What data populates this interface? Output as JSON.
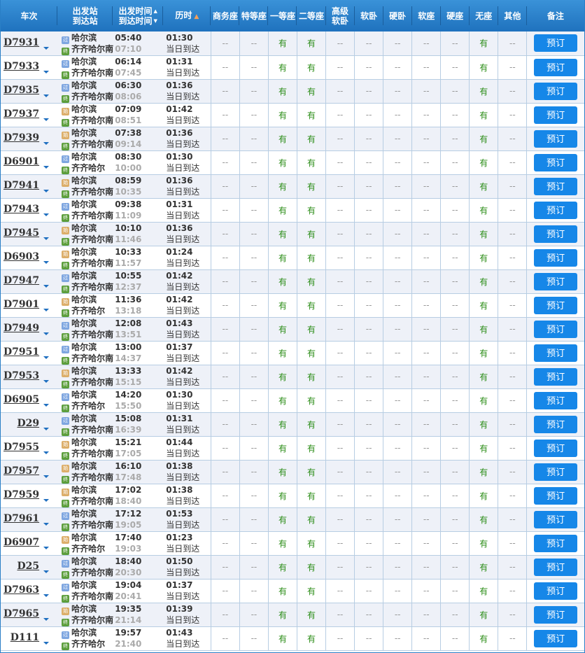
{
  "header": {
    "train": "车次",
    "stations_top": "出发站",
    "stations_bottom": "到达站",
    "times_top": "出发时间",
    "times_bottom": "到达时间",
    "duration": "历时",
    "seat_columns": [
      "商务座",
      "特等座",
      "一等座",
      "二等座",
      "高级软卧",
      "软卧",
      "硬卧",
      "软座",
      "硬座",
      "无座",
      "其他"
    ],
    "seat_col_gaoji_top": "高级",
    "seat_col_gaoji_bottom": "软卧",
    "remark": "备注"
  },
  "icons": {
    "guo": {
      "name": "pass-through-station-icon",
      "glyph": "过",
      "color": "#7ea6e0"
    },
    "shi": {
      "name": "origin-station-icon",
      "glyph": "始",
      "color": "#dcae6a"
    },
    "zhong": {
      "name": "terminal-station-icon",
      "glyph": "终",
      "color": "#5c9e3c"
    }
  },
  "labels": {
    "same_day_arrival": "当日到达",
    "book": "预订",
    "available": "有",
    "none": "--"
  },
  "colors": {
    "header_bg": "#2a7fc6",
    "available_text": "#2a8c16",
    "book_button": "#1687e8"
  },
  "rows": [
    {
      "train": "D7931",
      "dep_type": "guo",
      "from": "哈尔滨",
      "to": "齐齐哈尔南",
      "dep": "05:40",
      "arr": "07:10",
      "duration": "01:30"
    },
    {
      "train": "D7933",
      "dep_type": "guo",
      "from": "哈尔滨",
      "to": "齐齐哈尔南",
      "dep": "06:14",
      "arr": "07:45",
      "duration": "01:31"
    },
    {
      "train": "D7935",
      "dep_type": "guo",
      "from": "哈尔滨",
      "to": "齐齐哈尔南",
      "dep": "06:30",
      "arr": "08:06",
      "duration": "01:36"
    },
    {
      "train": "D7937",
      "dep_type": "shi",
      "from": "哈尔滨",
      "to": "齐齐哈尔南",
      "dep": "07:09",
      "arr": "08:51",
      "duration": "01:42"
    },
    {
      "train": "D7939",
      "dep_type": "shi",
      "from": "哈尔滨",
      "to": "齐齐哈尔南",
      "dep": "07:38",
      "arr": "09:14",
      "duration": "01:36"
    },
    {
      "train": "D6901",
      "dep_type": "guo",
      "from": "哈尔滨",
      "to": "齐齐哈尔",
      "dep": "08:30",
      "arr": "10:00",
      "duration": "01:30"
    },
    {
      "train": "D7941",
      "dep_type": "shi",
      "from": "哈尔滨",
      "to": "齐齐哈尔南",
      "dep": "08:59",
      "arr": "10:35",
      "duration": "01:36"
    },
    {
      "train": "D7943",
      "dep_type": "guo",
      "from": "哈尔滨",
      "to": "齐齐哈尔南",
      "dep": "09:38",
      "arr": "11:09",
      "duration": "01:31"
    },
    {
      "train": "D7945",
      "dep_type": "shi",
      "from": "哈尔滨",
      "to": "齐齐哈尔南",
      "dep": "10:10",
      "arr": "11:46",
      "duration": "01:36"
    },
    {
      "train": "D6903",
      "dep_type": "shi",
      "from": "哈尔滨",
      "to": "齐齐哈尔南",
      "dep": "10:33",
      "arr": "11:57",
      "duration": "01:24"
    },
    {
      "train": "D7947",
      "dep_type": "guo",
      "from": "哈尔滨",
      "to": "齐齐哈尔南",
      "dep": "10:55",
      "arr": "12:37",
      "duration": "01:42"
    },
    {
      "train": "D7901",
      "dep_type": "shi",
      "from": "哈尔滨",
      "to": "齐齐哈尔",
      "dep": "11:36",
      "arr": "13:18",
      "duration": "01:42"
    },
    {
      "train": "D7949",
      "dep_type": "guo",
      "from": "哈尔滨",
      "to": "齐齐哈尔南",
      "dep": "12:08",
      "arr": "13:51",
      "duration": "01:43"
    },
    {
      "train": "D7951",
      "dep_type": "guo",
      "from": "哈尔滨",
      "to": "齐齐哈尔南",
      "dep": "13:00",
      "arr": "14:37",
      "duration": "01:37"
    },
    {
      "train": "D7953",
      "dep_type": "shi",
      "from": "哈尔滨",
      "to": "齐齐哈尔南",
      "dep": "13:33",
      "arr": "15:15",
      "duration": "01:42"
    },
    {
      "train": "D6905",
      "dep_type": "guo",
      "from": "哈尔滨",
      "to": "齐齐哈尔",
      "dep": "14:20",
      "arr": "15:50",
      "duration": "01:30"
    },
    {
      "train": "D29",
      "dep_type": "guo",
      "from": "哈尔滨",
      "to": "齐齐哈尔南",
      "dep": "15:08",
      "arr": "16:39",
      "duration": "01:31"
    },
    {
      "train": "D7955",
      "dep_type": "shi",
      "from": "哈尔滨",
      "to": "齐齐哈尔南",
      "dep": "15:21",
      "arr": "17:05",
      "duration": "01:44"
    },
    {
      "train": "D7957",
      "dep_type": "shi",
      "from": "哈尔滨",
      "to": "齐齐哈尔南",
      "dep": "16:10",
      "arr": "17:48",
      "duration": "01:38"
    },
    {
      "train": "D7959",
      "dep_type": "shi",
      "from": "哈尔滨",
      "to": "齐齐哈尔南",
      "dep": "17:02",
      "arr": "18:40",
      "duration": "01:38"
    },
    {
      "train": "D7961",
      "dep_type": "guo",
      "from": "哈尔滨",
      "to": "齐齐哈尔南",
      "dep": "17:12",
      "arr": "19:05",
      "duration": "01:53"
    },
    {
      "train": "D6907",
      "dep_type": "shi",
      "from": "哈尔滨",
      "to": "齐齐哈尔",
      "dep": "17:40",
      "arr": "19:03",
      "duration": "01:23"
    },
    {
      "train": "D25",
      "dep_type": "guo",
      "from": "哈尔滨",
      "to": "齐齐哈尔南",
      "dep": "18:40",
      "arr": "20:30",
      "duration": "01:50"
    },
    {
      "train": "D7963",
      "dep_type": "guo",
      "from": "哈尔滨",
      "to": "齐齐哈尔南",
      "dep": "19:04",
      "arr": "20:41",
      "duration": "01:37"
    },
    {
      "train": "D7965",
      "dep_type": "shi",
      "from": "哈尔滨",
      "to": "齐齐哈尔南",
      "dep": "19:35",
      "arr": "21:14",
      "duration": "01:39"
    },
    {
      "train": "D111",
      "dep_type": "guo",
      "from": "哈尔滨",
      "to": "齐齐哈尔",
      "dep": "19:57",
      "arr": "21:40",
      "duration": "01:43"
    }
  ],
  "seat_availability": [
    "--",
    "--",
    "有",
    "有",
    "--",
    "--",
    "--",
    "--",
    "--",
    "有",
    "--"
  ]
}
